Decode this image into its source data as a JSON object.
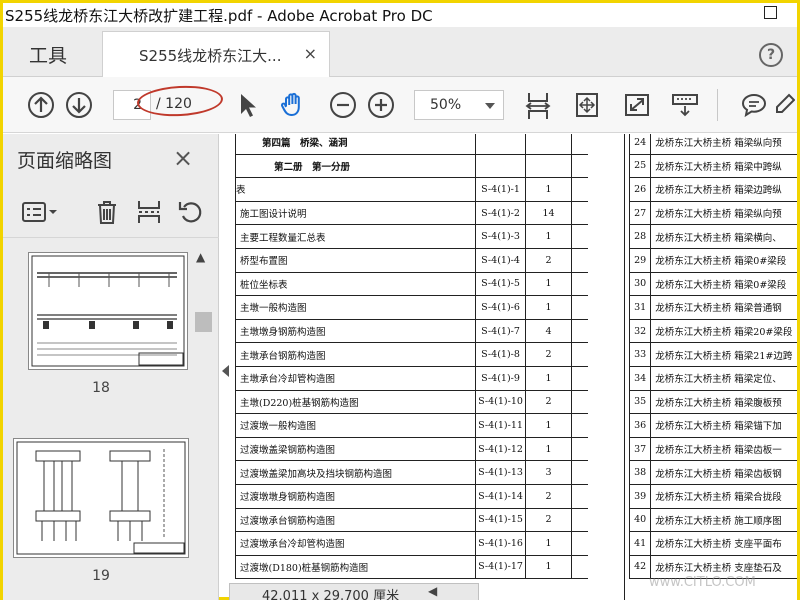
{
  "window": {
    "title": "S255线龙桥东江大桥改扩建工程.pdf - Adobe Acrobat Pro DC"
  },
  "tabs": {
    "tools_label": "工具",
    "doc_label": "S255线龙桥东江大...",
    "close_glyph": "×"
  },
  "help": {
    "glyph": "?"
  },
  "toolbar": {
    "current_page": "2",
    "page_total": "/ 120",
    "zoom": "50%"
  },
  "sidebar": {
    "title": "页面缩略图",
    "close_glyph": "×",
    "thumbnails": [
      {
        "label": "18"
      },
      {
        "label": "19"
      }
    ]
  },
  "document": {
    "left_rows": [
      {
        "name": "第四篇　桥梁、涵洞",
        "code": "",
        "count": "",
        "style": "bold-section"
      },
      {
        "name": "第二册　第一分册",
        "code": "",
        "count": "",
        "style": "bold-sub"
      },
      {
        "name": "表",
        "code": "S-4(1)-1",
        "count": "1",
        "style": "flush"
      },
      {
        "name": "施工图设计说明",
        "code": "S-4(1)-2",
        "count": "14",
        "style": ""
      },
      {
        "name": "主要工程数量汇总表",
        "code": "S-4(1)-3",
        "count": "1",
        "style": ""
      },
      {
        "name": "桥型布置图",
        "code": "S-4(1)-4",
        "count": "2",
        "style": ""
      },
      {
        "name": "桩位坐标表",
        "code": "S-4(1)-5",
        "count": "1",
        "style": ""
      },
      {
        "name": "主墩一般构造图",
        "code": "S-4(1)-6",
        "count": "1",
        "style": ""
      },
      {
        "name": "主墩墩身钢筋构造图",
        "code": "S-4(1)-7",
        "count": "4",
        "style": ""
      },
      {
        "name": "主墩承台钢筋构造图",
        "code": "S-4(1)-8",
        "count": "2",
        "style": ""
      },
      {
        "name": "主墩承台冷却管构造图",
        "code": "S-4(1)-9",
        "count": "1",
        "style": ""
      },
      {
        "name": "主墩(D220)桩基钢筋构造图",
        "code": "S-4(1)-10",
        "count": "2",
        "style": ""
      },
      {
        "name": "过渡墩一般构造图",
        "code": "S-4(1)-11",
        "count": "1",
        "style": ""
      },
      {
        "name": "过渡墩盖梁钢筋构造图",
        "code": "S-4(1)-12",
        "count": "1",
        "style": ""
      },
      {
        "name": "过渡墩盖梁加高块及挡块钢筋构造图",
        "code": "S-4(1)-13",
        "count": "3",
        "style": ""
      },
      {
        "name": "过渡墩墩身钢筋构造图",
        "code": "S-4(1)-14",
        "count": "2",
        "style": ""
      },
      {
        "name": "过渡墩承台钢筋构造图",
        "code": "S-4(1)-15",
        "count": "2",
        "style": ""
      },
      {
        "name": "过渡墩承台冷却管构造图",
        "code": "S-4(1)-16",
        "count": "1",
        "style": ""
      },
      {
        "name": "过渡墩(D180)桩基钢筋构造图",
        "code": "S-4(1)-17",
        "count": "1",
        "style": ""
      }
    ],
    "right_rows": [
      {
        "num": "24",
        "desc": "龙桥东江大桥主桥 箱梁纵向预"
      },
      {
        "num": "25",
        "desc": "龙桥东江大桥主桥 箱梁中跨纵"
      },
      {
        "num": "26",
        "desc": "龙桥东江大桥主桥 箱梁边跨纵"
      },
      {
        "num": "27",
        "desc": "龙桥东江大桥主桥 箱梁纵向预"
      },
      {
        "num": "28",
        "desc": "龙桥东江大桥主桥 箱梁横向、"
      },
      {
        "num": "29",
        "desc": "龙桥东江大桥主桥 箱梁0#梁段"
      },
      {
        "num": "30",
        "desc": "龙桥东江大桥主桥 箱梁0#梁段"
      },
      {
        "num": "31",
        "desc": "龙桥东江大桥主桥 箱梁普通钢"
      },
      {
        "num": "32",
        "desc": "龙桥东江大桥主桥 箱梁20#梁段"
      },
      {
        "num": "33",
        "desc": "龙桥东江大桥主桥 箱梁21#边跨"
      },
      {
        "num": "34",
        "desc": "龙桥东江大桥主桥 箱梁定位、"
      },
      {
        "num": "35",
        "desc": "龙桥东江大桥主桥 箱梁腹板预"
      },
      {
        "num": "36",
        "desc": "龙桥东江大桥主桥 箱梁锚下加"
      },
      {
        "num": "37",
        "desc": "龙桥东江大桥主桥 箱梁齿板一"
      },
      {
        "num": "38",
        "desc": "龙桥东江大桥主桥 箱梁齿板钢"
      },
      {
        "num": "39",
        "desc": "龙桥东江大桥主桥 箱梁合拢段"
      },
      {
        "num": "40",
        "desc": "龙桥东江大桥主桥 施工顺序图"
      },
      {
        "num": "41",
        "desc": "龙桥东江大桥主桥 支座平面布"
      },
      {
        "num": "42",
        "desc": "龙桥东江大桥主桥 支座垫石及"
      }
    ]
  },
  "statusbar": {
    "page_size": "42.011 x 29.700 厘米"
  },
  "watermark": {
    "text": "www.CITLO.COM"
  },
  "colors": {
    "annotation_oval": "#c0392b",
    "hand_tool": "#1a6fd6",
    "frame": "#f2d400"
  }
}
